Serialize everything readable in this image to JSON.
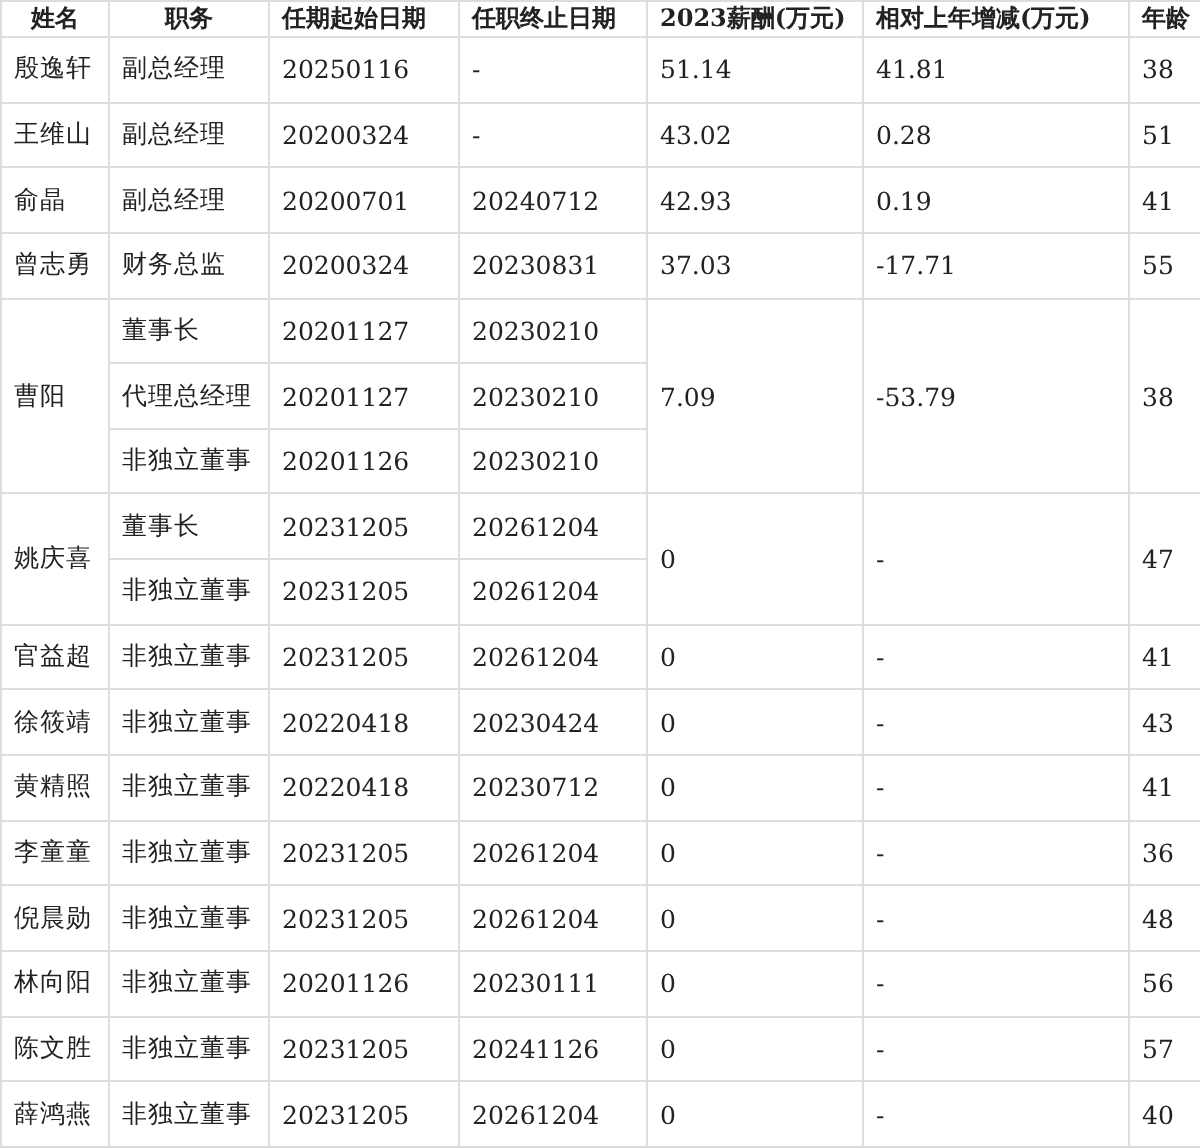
{
  "table": {
    "columns": [
      "姓名",
      "职务",
      "任期起始日期",
      "任职终止日期",
      "2023薪酬(万元)",
      "相对上年增减(万元)",
      "年龄"
    ],
    "rows": [
      {
        "name": "殷逸轩",
        "roles": [
          {
            "title": "副总经理",
            "start": "20250116",
            "end": "-"
          }
        ],
        "salary": "51.14",
        "change": "41.81",
        "age": "38"
      },
      {
        "name": "王维山",
        "roles": [
          {
            "title": "副总经理",
            "start": "20200324",
            "end": "-"
          }
        ],
        "salary": "43.02",
        "change": "0.28",
        "age": "51"
      },
      {
        "name": "俞晶",
        "roles": [
          {
            "title": "副总经理",
            "start": "20200701",
            "end": "20240712"
          }
        ],
        "salary": "42.93",
        "change": "0.19",
        "age": "41"
      },
      {
        "name": "曾志勇",
        "roles": [
          {
            "title": "财务总监",
            "start": "20200324",
            "end": "20230831"
          }
        ],
        "salary": "37.03",
        "change": "-17.71",
        "age": "55"
      },
      {
        "name": "曹阳",
        "roles": [
          {
            "title": "董事长",
            "start": "20201127",
            "end": "20230210"
          },
          {
            "title": "代理总经理",
            "start": "20201127",
            "end": "20230210"
          },
          {
            "title": "非独立董事",
            "start": "20201126",
            "end": "20230210"
          }
        ],
        "salary": "7.09",
        "change": "-53.79",
        "age": "38"
      },
      {
        "name": "姚庆喜",
        "roles": [
          {
            "title": "董事长",
            "start": "20231205",
            "end": "20261204"
          },
          {
            "title": "非独立董事",
            "start": "20231205",
            "end": "20261204"
          }
        ],
        "salary": "0",
        "change": "-",
        "age": "47"
      },
      {
        "name": "官益超",
        "roles": [
          {
            "title": "非独立董事",
            "start": "20231205",
            "end": "20261204"
          }
        ],
        "salary": "0",
        "change": "-",
        "age": "41"
      },
      {
        "name": "徐筱靖",
        "roles": [
          {
            "title": "非独立董事",
            "start": "20220418",
            "end": "20230424"
          }
        ],
        "salary": "0",
        "change": "-",
        "age": "43"
      },
      {
        "name": "黄精照",
        "roles": [
          {
            "title": "非独立董事",
            "start": "20220418",
            "end": "20230712"
          }
        ],
        "salary": "0",
        "change": "-",
        "age": "41"
      },
      {
        "name": "李童童",
        "roles": [
          {
            "title": "非独立董事",
            "start": "20231205",
            "end": "20261204"
          }
        ],
        "salary": "0",
        "change": "-",
        "age": "36"
      },
      {
        "name": "倪晨勋",
        "roles": [
          {
            "title": "非独立董事",
            "start": "20231205",
            "end": "20261204"
          }
        ],
        "salary": "0",
        "change": "-",
        "age": "48"
      },
      {
        "name": "林向阳",
        "roles": [
          {
            "title": "非独立董事",
            "start": "20201126",
            "end": "20230111"
          }
        ],
        "salary": "0",
        "change": "-",
        "age": "56"
      },
      {
        "name": "陈文胜",
        "roles": [
          {
            "title": "非独立董事",
            "start": "20231205",
            "end": "20241126"
          }
        ],
        "salary": "0",
        "change": "-",
        "age": "57"
      },
      {
        "name": "薛鸿燕",
        "roles": [
          {
            "title": "非独立董事",
            "start": "20231205",
            "end": "20261204"
          }
        ],
        "salary": "0",
        "change": "-",
        "age": "40"
      }
    ]
  }
}
